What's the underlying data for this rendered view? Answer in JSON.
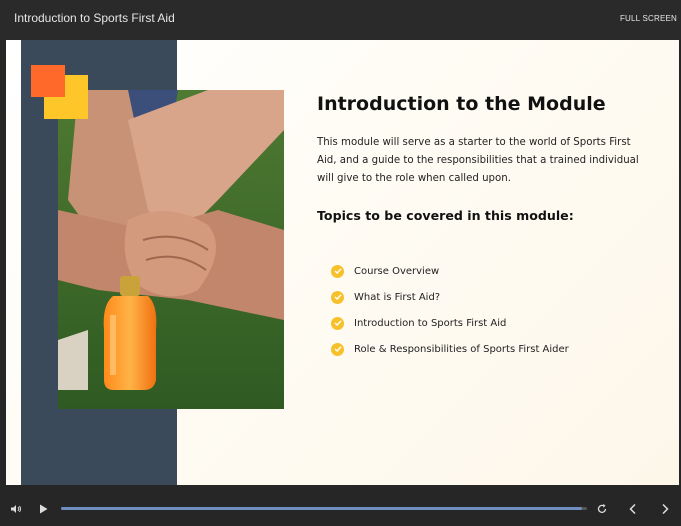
{
  "header": {
    "course_title": "Introduction to Sports First Aid",
    "fullscreen_label": "FULL SCREEN"
  },
  "slide": {
    "heading": "Introduction to the Module",
    "description": "This module will serve as a starter to the world of Sports First Aid, and a guide to the responsibilities that a trained individual will give to the role when called upon.",
    "topics_heading": "Topics to be covered in this module:",
    "topics": [
      "Course Overview",
      "What is First Aid?",
      "Introduction to Sports First Aid",
      "Role & Responsibilities of Sports First Aider"
    ],
    "colors": {
      "side_panel": "#3a4a5a",
      "accent_orange": "#ff6a2a",
      "accent_yellow": "#ffc629",
      "check": "#f7c12b"
    }
  },
  "controls": {
    "icons": [
      "volume-icon",
      "play-icon",
      "replay-icon",
      "chevron-left-icon",
      "chevron-right-icon"
    ],
    "progress_fraction": 0.99,
    "progress_color": "#6f8fc0"
  }
}
